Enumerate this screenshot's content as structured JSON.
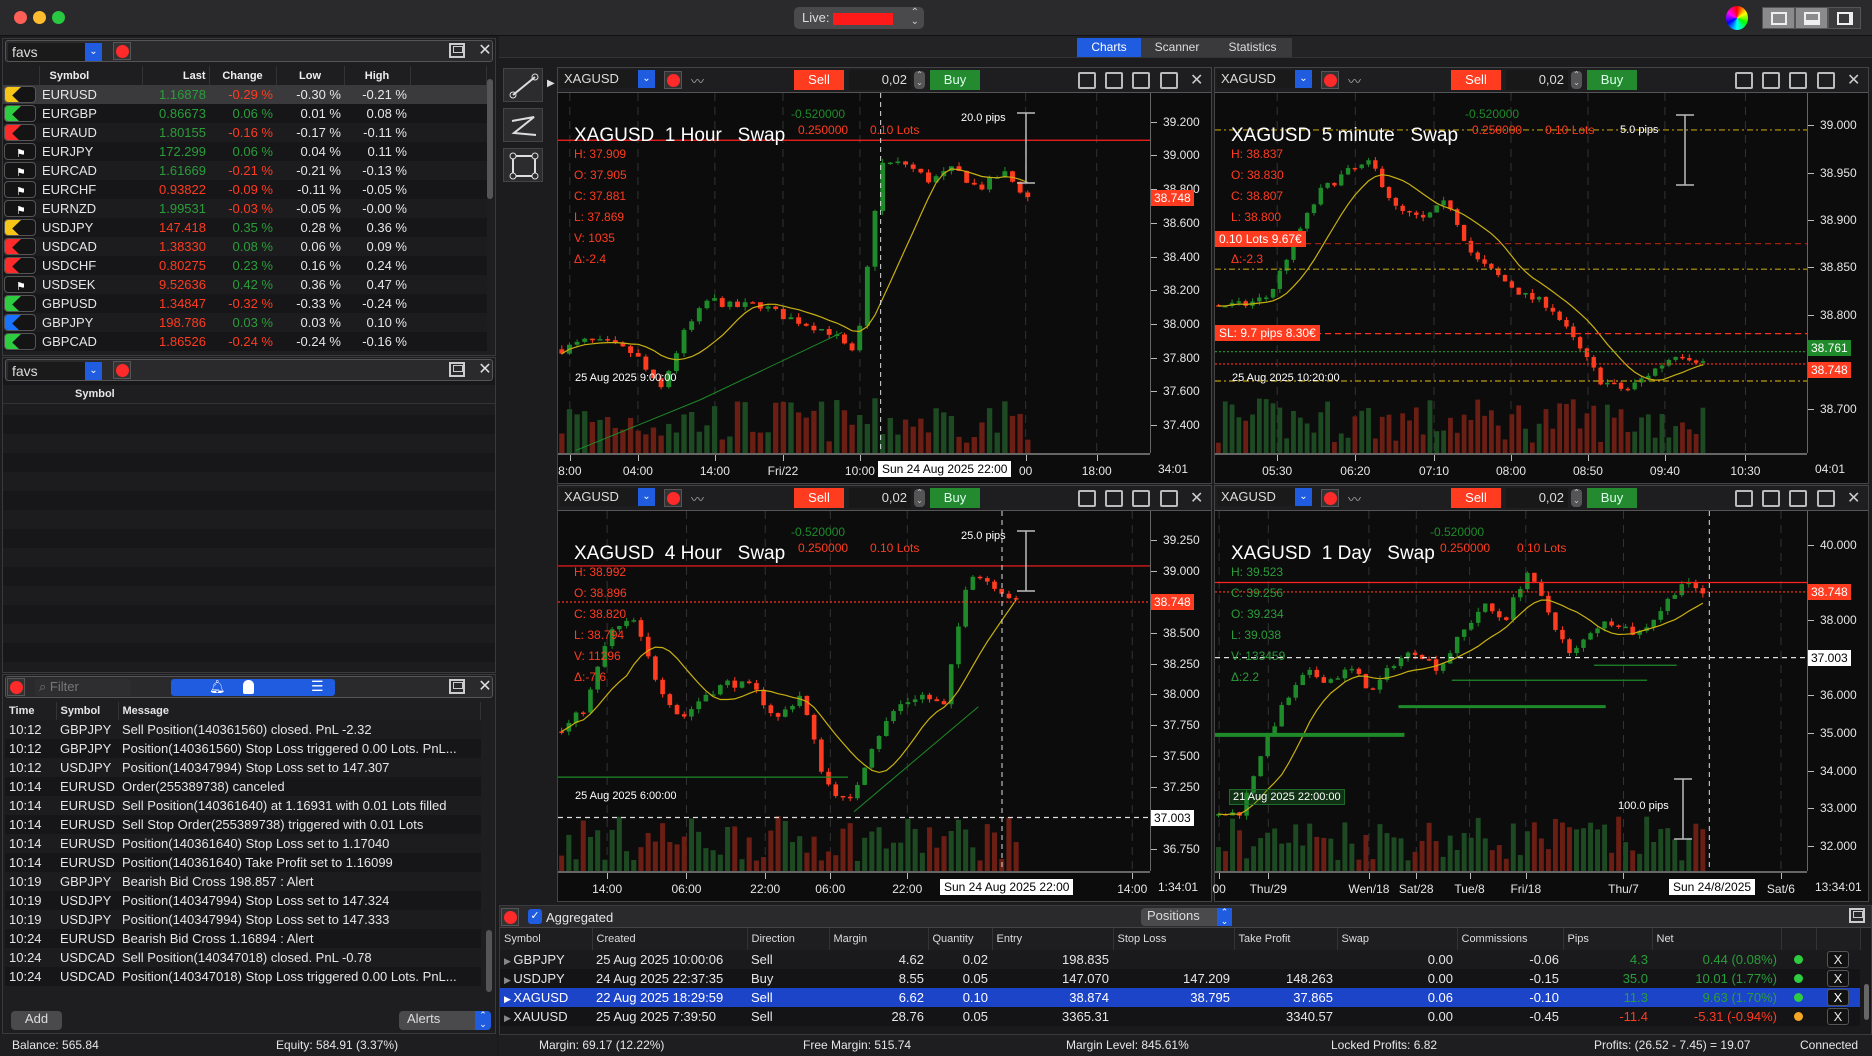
{
  "window": {
    "account_label": "Live:",
    "tabs": [
      "Charts",
      "Scanner",
      "Statistics"
    ],
    "active_tab": "Charts"
  },
  "watchlist1": {
    "name": "favs",
    "columns": [
      "Symbol",
      "Last",
      "Change",
      "Low",
      "High"
    ],
    "rows": [
      {
        "flag": "#f5c518",
        "symbol": "EURUSD",
        "last": "1.16878",
        "lastc": "g",
        "change": "-0.29 %",
        "chc": "r2",
        "low": "-0.30 %",
        "high": "-0.21 %"
      },
      {
        "flag": "#2ecc40",
        "symbol": "EURGBP",
        "last": "0.86673",
        "lastc": "g",
        "change": "0.06 %",
        "chc": "g",
        "low": "0.01 %",
        "high": "0.08 %"
      },
      {
        "flag": "#ff2a2a",
        "symbol": "EURAUD",
        "last": "1.80155",
        "lastc": "g",
        "change": "-0.16 %",
        "chc": "r2",
        "low": "-0.17 %",
        "high": "-0.11 %"
      },
      {
        "flag": "white",
        "symbol": "EURJPY",
        "last": "172.299",
        "lastc": "g",
        "change": "0.06 %",
        "chc": "g",
        "low": "0.04 %",
        "high": "0.11 %"
      },
      {
        "flag": "white",
        "symbol": "EURCAD",
        "last": "1.61669",
        "lastc": "g",
        "change": "-0.21 %",
        "chc": "r2",
        "low": "-0.21 %",
        "high": "-0.13 %"
      },
      {
        "flag": "white",
        "symbol": "EURCHF",
        "last": "0.93822",
        "lastc": "r2",
        "change": "-0.09 %",
        "chc": "r2",
        "low": "-0.11 %",
        "high": "-0.05 %"
      },
      {
        "flag": "white",
        "symbol": "EURNZD",
        "last": "1.99531",
        "lastc": "g",
        "change": "-0.03 %",
        "chc": "r2",
        "low": "-0.05 %",
        "high": "-0.00 %"
      },
      {
        "flag": "#f5c518",
        "symbol": "USDJPY",
        "last": "147.418",
        "lastc": "r2",
        "change": "0.35 %",
        "chc": "g",
        "low": "0.28 %",
        "high": "0.36 %"
      },
      {
        "flag": "#ff2a2a",
        "symbol": "USDCAD",
        "last": "1.38330",
        "lastc": "r2",
        "change": "0.08 %",
        "chc": "g",
        "low": "0.06 %",
        "high": "0.09 %"
      },
      {
        "flag": "#ff2a2a",
        "symbol": "USDCHF",
        "last": "0.80275",
        "lastc": "r2",
        "change": "0.23 %",
        "chc": "g",
        "low": "0.16 %",
        "high": "0.24 %"
      },
      {
        "flag": "white",
        "symbol": "USDSEK",
        "last": "9.52636",
        "lastc": "r2",
        "change": "0.42 %",
        "chc": "g",
        "low": "0.36 %",
        "high": "0.47 %"
      },
      {
        "flag": "#2ecc40",
        "symbol": "GBPUSD",
        "last": "1.34847",
        "lastc": "r2",
        "change": "-0.32 %",
        "chc": "r2",
        "low": "-0.33 %",
        "high": "-0.24 %"
      },
      {
        "flag": "#1a73ff",
        "symbol": "GBPJPY",
        "last": "198.786",
        "lastc": "r2",
        "change": "0.03 %",
        "chc": "g",
        "low": "0.03 %",
        "high": "0.10 %"
      },
      {
        "flag": "#2ecc40",
        "symbol": "GBPCAD",
        "last": "1.86526",
        "lastc": "r2",
        "change": "-0.24 %",
        "chc": "r2",
        "low": "-0.24 %",
        "high": "-0.16 %"
      }
    ]
  },
  "watchlist2": {
    "name": "favs",
    "columns": [
      "Symbol"
    ]
  },
  "alerts": {
    "filter_placeholder": "Filter",
    "columns": [
      "Time",
      "Symbol",
      "Message"
    ],
    "rows": [
      [
        "10:12",
        "GBPJPY",
        "Sell Position(140361560) closed. PnL -2.32"
      ],
      [
        "10:12",
        "GBPJPY",
        "Position(140361560) Stop Loss triggered 0.00 Lots. PnL..."
      ],
      [
        "10:12",
        "USDJPY",
        "Position(140347994) Stop Loss set to 147.307"
      ],
      [
        "10:14",
        "EURUSD",
        "Order(255389738) canceled"
      ],
      [
        "10:14",
        "EURUSD",
        "Sell Position(140361640) at 1.16931 with 0.01 Lots filled"
      ],
      [
        "10:14",
        "EURUSD",
        "Sell  Stop Order(255389738) triggered with 0.01 Lots"
      ],
      [
        "10:14",
        "EURUSD",
        "Position(140361640) Stop Loss set to 1.17040"
      ],
      [
        "10:14",
        "EURUSD",
        "Position(140361640) Take Profit set to 1.16099"
      ],
      [
        "10:19",
        "GBPJPY",
        "Bearish Bid Cross 198.857 : Alert"
      ],
      [
        "10:19",
        "USDJPY",
        "Position(140347994) Stop Loss set to 147.324"
      ],
      [
        "10:19",
        "USDJPY",
        "Position(140347994) Stop Loss set to 147.333"
      ],
      [
        "10:24",
        "EURUSD",
        "Bearish Bid Cross 1.16894 : Alert"
      ],
      [
        "10:24",
        "USDCAD",
        "Sell Position(140347018) closed. PnL -0.78"
      ],
      [
        "10:24",
        "USDCAD",
        "Position(140347018) Stop Loss triggered 0.00 Lots. PnL..."
      ]
    ],
    "add_label": "Add",
    "mode_select": "Alerts"
  },
  "account": {
    "balance": "Balance: 565.84",
    "equity": "Equity: 584.91 (3.37%)"
  },
  "charts": [
    {
      "symbol": "XAGUSD",
      "title": "XAGUSD  1 Hour   Swap",
      "swap_long": "-0.520000",
      "swap_short": "0.250000",
      "lots": "0.10 Lots",
      "qty": "0,02",
      "sell": "Sell",
      "buy": "Buy",
      "info_color": "#ff3b20",
      "info": [
        "H: 37.909",
        "O: 37.905",
        "C: 37.881",
        "L: 37.869",
        "V: 1035",
        "Δ:-2.4"
      ],
      "range": [
        37.235,
        39.37
      ],
      "yticks": [
        "39.200",
        "39.000",
        "38.800",
        "38.600",
        "38.400",
        "38.200",
        "38.000",
        "37.800",
        "37.600",
        "37.400"
      ],
      "xlabels": [
        "8:00",
        "04:00",
        "14:00",
        "Fri/22",
        "10:00",
        "00",
        "18:00"
      ],
      "cursor_time": "Sun 24 Aug 2025 22:00",
      "countdown": "34:01",
      "overlay_time": "25 Aug 2025 9:00:00",
      "pips": "20.0 pips",
      "last_price": "38.748",
      "price_path": [
        37.85,
        37.9,
        37.88,
        37.82,
        37.6,
        37.95,
        38.15,
        38.1,
        38.12,
        38.05,
        38.0,
        37.95,
        37.8,
        38.95,
        38.95,
        38.85,
        38.92,
        38.8,
        38.9,
        38.75
      ]
    },
    {
      "symbol": "XAGUSD",
      "title": "XAGUSD  5 minute   Swap",
      "swap_long": "-0.520000",
      "swap_short": "0.250000",
      "lots": "0.10 Lots",
      "qty": "0,02",
      "sell": "Sell",
      "buy": "Buy",
      "info_color": "#ff3b20",
      "info": [
        "H: 38.837",
        "O: 38.830",
        "C: 38.807",
        "L: 38.800",
        "0.10 Lots 9.67€",
        "Δ:-2.3"
      ],
      "range": [
        38.654,
        39.034
      ],
      "yticks": [
        "39.000",
        "38.950",
        "38.900",
        "38.850",
        "38.800",
        "38.700"
      ],
      "xlabels": [
        "05:30",
        "06:20",
        "07:10",
        "08:00",
        "08:50",
        "09:40",
        "10:30"
      ],
      "countdown": "04:01",
      "overlay_time": "25 Aug 2025 10:20:00",
      "pips": "5.0 pips",
      "last_price": "38.748",
      "ask_price": "38.761",
      "sl_label": "SL: 9.7 pips 8.30€",
      "price_path": [
        38.81,
        38.81,
        38.82,
        38.88,
        38.93,
        38.95,
        38.96,
        38.91,
        38.9,
        38.92,
        38.86,
        38.84,
        38.82,
        38.81,
        38.77,
        38.73,
        38.72,
        38.74,
        38.76,
        38.75
      ]
    },
    {
      "symbol": "XAGUSD",
      "title": "XAGUSD  4 Hour   Swap",
      "swap_long": "-0.520000",
      "swap_short": "0.250000",
      "lots": "0.10 Lots",
      "qty": "0,02",
      "sell": "Sell",
      "buy": "Buy",
      "info_color": "#ff3b20",
      "info": [
        "H: 38.992",
        "O: 38.896",
        "C: 38.820",
        "L: 38.794",
        "V: 11296",
        "Δ:-7.6"
      ],
      "range": [
        36.57,
        39.485
      ],
      "yticks": [
        "39.250",
        "39.000",
        "38.500",
        "38.250",
        "38.000",
        "37.750",
        "37.500",
        "37.250",
        "36.750"
      ],
      "xlabels": [
        "14:00",
        "06:00",
        "22:00",
        "06:00",
        "22:00",
        "14:00"
      ],
      "cursor_time": "Sun 24 Aug 2025 22:00",
      "countdown": "1:34:01",
      "overlay_time": "25 Aug 2025 6:00:00",
      "pips": "25.0 pips",
      "last_price": "38.748",
      "cross_price": "37.003",
      "price_path": [
        37.7,
        37.9,
        38.5,
        38.6,
        38.1,
        37.8,
        38.0,
        38.1,
        38.05,
        37.8,
        38.0,
        37.3,
        37.1,
        37.6,
        37.9,
        38.0,
        37.9,
        39.0,
        38.9,
        38.75
      ]
    },
    {
      "symbol": "XAGUSD",
      "title": "XAGUSD  1 Day   Swap",
      "swap_long": "-0.520000",
      "swap_short": "0.250000",
      "lots": "0.10 Lots",
      "qty": "0,02",
      "sell": "Sell",
      "buy": "Buy",
      "info_color": "#2a9d3a",
      "info": [
        "H: 39.523",
        "C: 39.256",
        "O: 39.234",
        "L: 39.038",
        "V: 133459",
        "Δ:2.2"
      ],
      "range": [
        31.33,
        40.9
      ],
      "yticks": [
        "40.000",
        "38.000",
        "36.000",
        "35.000",
        "34.000",
        "33.000",
        "32.000"
      ],
      "xlabels": [
        "00",
        "Thu/29",
        "Wen/18",
        "Sat/28",
        "Tue/8",
        "Fri/18",
        "Thu/7",
        "Sat/6"
      ],
      "cursor_time": "Sun 24/8/2025",
      "countdown": "13:34:01",
      "overlay_time": "21 Aug 2025 22:00:00",
      "pips": "100.0 pips",
      "last_price": "38.748",
      "cross_price": "37.003",
      "price_path": [
        32.8,
        32.9,
        34.6,
        35.8,
        36.6,
        36.4,
        36.7,
        36.1,
        36.9,
        37.2,
        36.7,
        37.6,
        38.4,
        38.0,
        39.3,
        38.2,
        37.0,
        37.8,
        38.0,
        37.6,
        38.2,
        39.0,
        38.75
      ]
    }
  ],
  "positions": {
    "aggregated_label": "Aggregated",
    "view_select": "Positions",
    "columns": [
      "Symbol",
      "Created",
      "Direction",
      "Margin",
      "Quantity",
      "Entry",
      "Stop Loss",
      "Take Profit",
      "Swap",
      "Commissions",
      "Pips",
      "Net"
    ],
    "rows": [
      {
        "symbol": "GBPJPY",
        "created": "25 Aug 2025 10:00:06",
        "direction": "Sell",
        "margin": "4.62",
        "quantity": "0.02",
        "entry": "198.835",
        "sl": "",
        "tp": "",
        "swap": "0.00",
        "comm": "-0.06",
        "pips": "4.3",
        "net": "0.44 (0.08%)",
        "pc": "g",
        "dot": "#2ecc40"
      },
      {
        "symbol": "USDJPY",
        "created": "24 Aug 2025 22:37:35",
        "direction": "Buy",
        "margin": "8.55",
        "quantity": "0.05",
        "entry": "147.070",
        "sl": "147.209",
        "tp": "148.263",
        "swap": "0.00",
        "comm": "-0.15",
        "pips": "35.0",
        "net": "10.01 (1.77%)",
        "pc": "g",
        "dot": "#2ecc40"
      },
      {
        "symbol": "XAGUSD",
        "created": "22 Aug 2025 18:29:59",
        "direction": "Sell",
        "margin": "6.62",
        "quantity": "0.10",
        "entry": "38.874",
        "sl": "38.795",
        "tp": "37.865",
        "swap": "0.06",
        "comm": "-0.10",
        "pips": "11.3",
        "net": "9.63 (1.70%)",
        "pc": "g",
        "dot": "#2ecc40"
      },
      {
        "symbol": "XAUUSD",
        "created": "25 Aug 2025 7:39:50",
        "direction": "Sell",
        "margin": "28.76",
        "quantity": "0.05",
        "entry": "3365.31",
        "sl": "",
        "tp": "3340.57",
        "swap": "0.00",
        "comm": "-0.45",
        "pips": "-11.4",
        "net": "-5.31 (-0.94%)",
        "pc": "r2",
        "dot": "#f5a623"
      }
    ],
    "close_label": "X"
  },
  "status": {
    "margin": "Margin: 69.17 (12.22%)",
    "free_margin": "Free Margin: 515.74",
    "margin_level": "Margin Level: 845.61%",
    "locked": "Locked Profits: 6.82",
    "profits": "Profits: (26.52 - 7.45) = 19.07",
    "connection": "Connected"
  }
}
